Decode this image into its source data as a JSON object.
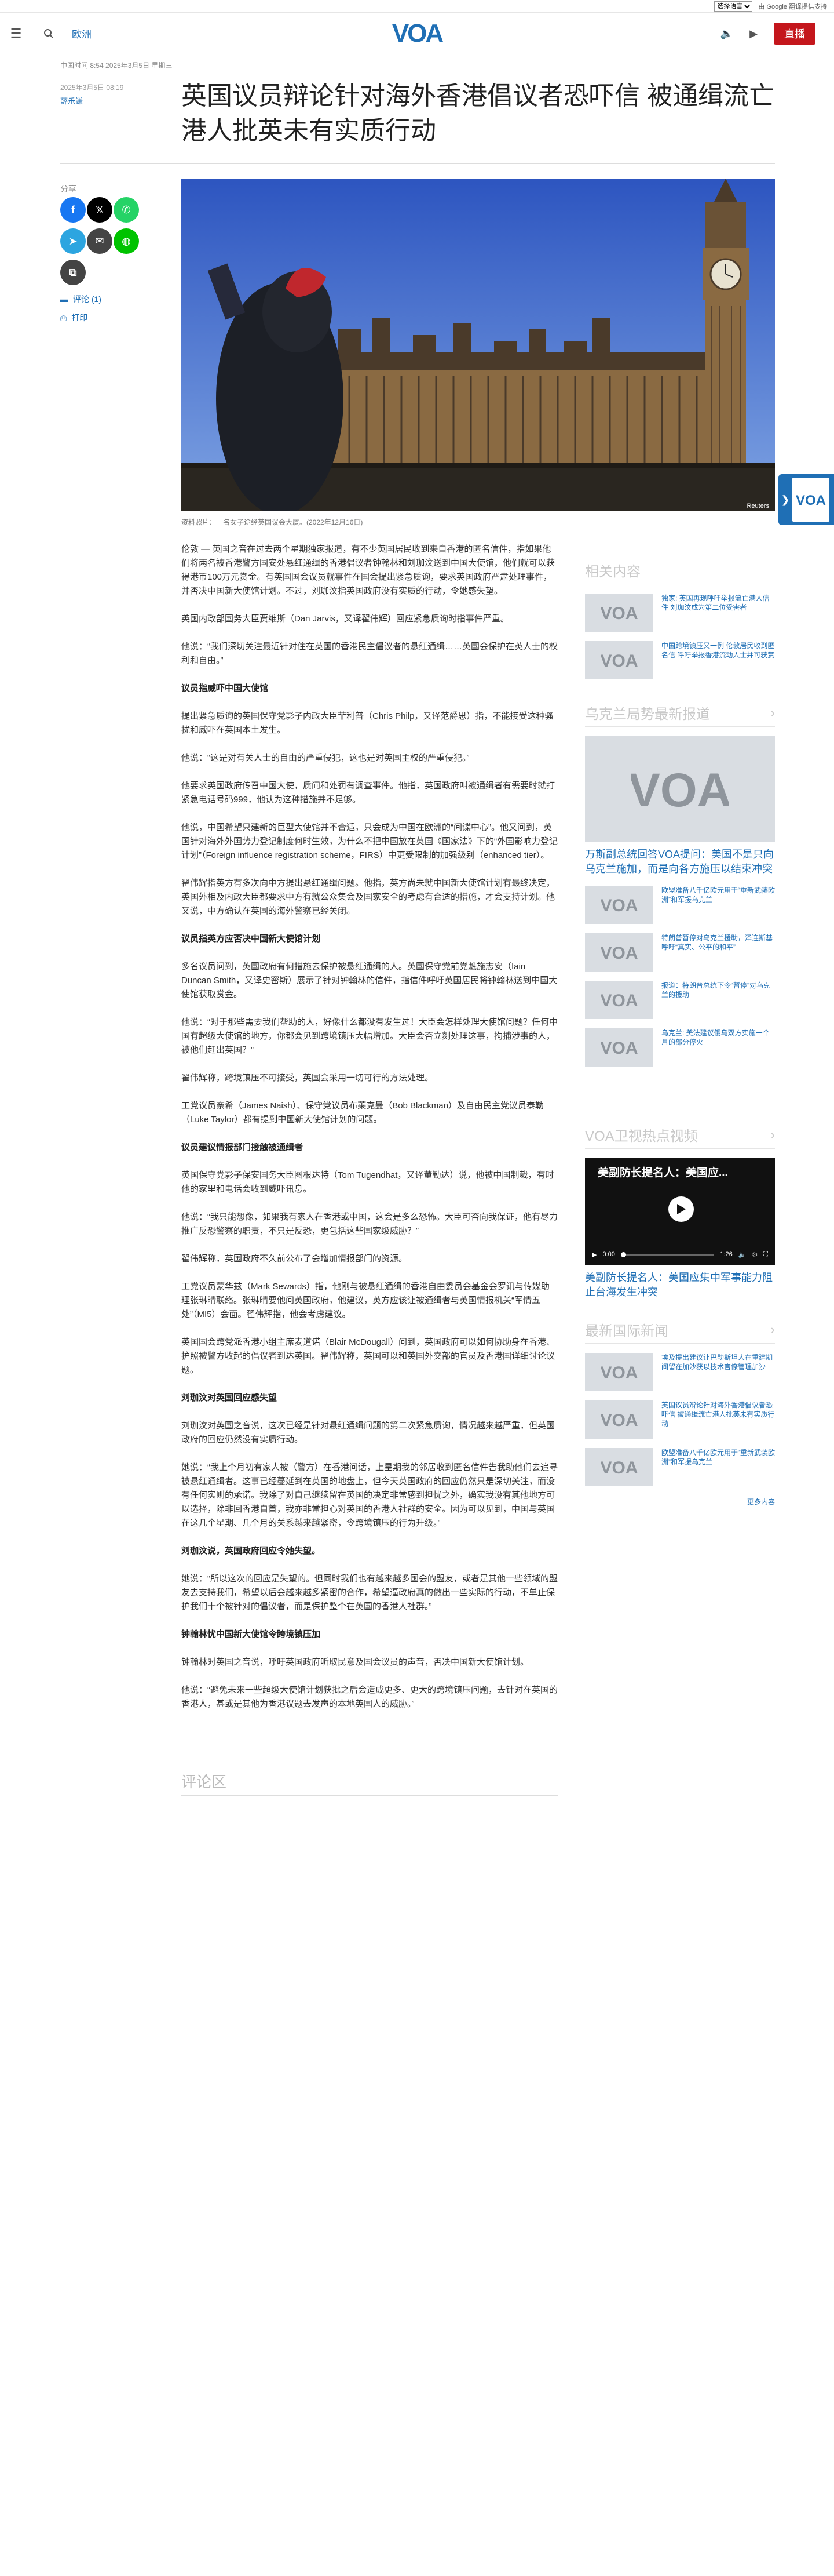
{
  "util": {
    "language_select": "选择语言",
    "translate_label": "由 Google 翻译提供支持"
  },
  "header": {
    "section": "欧洲",
    "logo": "VOA",
    "live_label": "直播"
  },
  "meta": {
    "dates": "中国时间 8:54 2025年3月5日 星期三",
    "updated": "2025年3月5日 08:19",
    "author": "薛乐謙"
  },
  "article": {
    "headline": "英国议员辩论针对海外香港倡议者恐吓信 被通缉流亡港人批英未有实质行动",
    "share_label": "分享",
    "comment_link": "评论 (1)",
    "print_link": "打印",
    "image_caption": "资料照片：一名女子途经英国议会大厦。(2022年12月16日)",
    "image_credit": "Reuters",
    "blocks": [
      {
        "type": "p",
        "text": "伦敦 — 英国之音在过去两个星期独家报道，有不少英国居民收到来自香港的匿名信件，指如果他们将两名被香港警方国安处悬红通缉的香港倡议者钟翰林和刘珈汶送到中国大使馆，他们就可以获得港币100万元赏金。有英国国会议员就事件在国会提出紧急质询，要求英国政府严肃处理事件，并否决中国新大使馆计划。不过，刘珈汶指英国政府没有实质的行动，令她感失望。"
      },
      {
        "type": "p",
        "text": "英国内政部国务大臣贾维斯（Dan Jarvis，又译翟伟辉）回应紧急质询时指事件严重。"
      },
      {
        "type": "p",
        "text": "他说：“我们深切关注最近针对住在英国的香港民主倡议者的悬红通缉……英国会保护在英人士的权利和自由。”"
      },
      {
        "type": "h",
        "text": "议员指威吓中国大使馆"
      },
      {
        "type": "p",
        "text": "提出紧急质询的英国保守党影子内政大臣菲利普（Chris Philp，又译范爵思）指，不能接受这种骚扰和威吓在英国本土发生。"
      },
      {
        "type": "p",
        "text": "他说：“这是对有关人士的自由的严重侵犯，这也是对英国主权的严重侵犯。”"
      },
      {
        "type": "p",
        "text": "他要求英国政府传召中国大使，质问和处罚有调查事件。他指，英国政府叫被通缉者有需要时就打紧急电话号码999，他认为这种措施并不足够。"
      },
      {
        "type": "p",
        "text": "他说，中国希望只建新的巨型大使馆并不合适，只会成为中国在欧洲的“间谍中心”。他又问到，英国针对海外外国势力登记制度何时生效，为什么不把中国放在英国《国家法》下的“外国影响力登记计划”（Foreign influence registration scheme，FIRS）中更受限制的加强级别（enhanced tier）。"
      },
      {
        "type": "p",
        "text": "翟伟辉指英方有多次向中方提出悬红通缉问题。他指，英方尚未就中国新大使馆计划有最终决定，英国外相及内政大臣都要求中方有就公众集会及国家安全的考虑有合适的措施，才会支持计划。他又说，中方确认在英国的海外警察已经关闭。"
      },
      {
        "type": "h",
        "text": "议员指英方应否决中国新大使馆计划"
      },
      {
        "type": "p",
        "text": "多名议员问到，英国政府有何措施去保护被悬红通缉的人。英国保守党前党魁施志安（Iain Duncan Smith，又译史密斯）展示了针对钟翰林的信件，指信件呼吁英国居民将钟翰林送到中国大使馆获取赏金。"
      },
      {
        "type": "p",
        "text": "他说：“对于那些需要我们帮助的人，好像什么都没有发生过！大臣会怎样处理大使馆问题？任何中国有超级大使馆的地方，你都会见到跨境镇压大幅增加。大臣会否立刻处理这事，拘捕涉事的人，被他们赶出英国？”"
      },
      {
        "type": "p",
        "text": "翟伟辉称，跨境镇压不可接受，英国会采用一切可行的方法处理。"
      },
      {
        "type": "p",
        "text": "工党议员奈希（James Naish）、保守党议员布莱克曼（Bob Blackman）及自由民主党议员泰勒（Luke Taylor）都有提到中国新大使馆计划的问题。"
      },
      {
        "type": "h",
        "text": "议员建议情报部门接触被通缉者"
      },
      {
        "type": "p",
        "text": "英国保守党影子保安国务大臣图根达特（Tom Tugendhat，又译董勤达）说，他被中国制裁，有时他的家里和电话会收到威吓讯息。"
      },
      {
        "type": "p",
        "text": "他说：“我只能想像，如果我有家人在香港或中国，这会是多么恐怖。大臣可否向我保证，他有尽力推广反恐警察的职责，不只是反恐，更包括这些国家级威胁？”"
      },
      {
        "type": "p",
        "text": "翟伟辉称，英国政府不久前公布了会增加情报部门的资源。"
      },
      {
        "type": "p",
        "text": "工党议员蒙华兹（Mark Sewards）指，他刚与被悬红通缉的香港自由委员会基金会罗讯与传媒助理张琳晴联络。张琳晴要他问英国政府，他建议，英方应该让被通缉者与英国情报机关“军情五处”（MI5）会面。翟伟辉指，他会考虑建议。"
      },
      {
        "type": "p",
        "text": "英国国会跨党派香港小组主席麦道诺（Blair McDougall）问到，英国政府可以如何协助身在香港、护照被警方收起的倡议者到达英国。翟伟辉称，英国可以和英国外交部的官员及香港国详细讨论议题。"
      },
      {
        "type": "h",
        "text": "刘珈汶对英国回应感失望"
      },
      {
        "type": "p",
        "text": "刘珈汶对英国之音说，这次已经是针对悬红通缉问题的第二次紧急质询，情况越来越严重，但英国政府的回应仍然没有实质行动。"
      },
      {
        "type": "p",
        "text": "她说：“我上个月初有家人被（警方）在香港问话，上星期我的邻居收到匿名信件告我助他们去追寻被悬红通缉者。这事已经蔓延到在英国的地盘上，但今天英国政府的回应仍然只是深切关注，而没有任何实则的承诺。我除了对自己继续留在英国的决定非常感到担忧之外，确实我没有其他地方可以选择，除非回香港自首，我亦非常担心对英国的香港人社群的安全。因为可以见到，中国与英国在这几个星期、几个月的关系越来越紧密，令跨境镇压的行为升级。”"
      },
      {
        "type": "h",
        "text": "刘珈汶说，英国政府回应令她失望。"
      },
      {
        "type": "p",
        "text": "她说：“所以这次的回应是失望的。但同时我们也有越来越多国会的盟友，或者是其他一些领域的盟友去支持我们，希望以后会越来越多紧密的合作，希望逼政府真的做出一些实际的行动，不单止保护我们十个被针对的倡议者，而是保护整个在英国的香港人社群。”"
      },
      {
        "type": "h",
        "text": "钟翰林忧中国新大使馆令跨境镇压加"
      },
      {
        "type": "p",
        "text": "钟翰林对英国之音说，呼吁英国政府听取民意及国会议员的声音，否决中国新大使馆计划。"
      },
      {
        "type": "p",
        "text": "他说：“避免未来一些超级大使馆计划获批之后会造成更多、更大的跨境镇压问题，去针对在英国的香港人，甚或是其他为香港议题去发声的本地英国人的威胁。”"
      }
    ],
    "comments_heading": "评论区"
  },
  "sidebar": {
    "related": {
      "heading": "相关内容",
      "items": [
        {
          "text": "独家: 英国再现呼吁举报流亡港人信件 刘珈汶成为第二位受害者"
        },
        {
          "text": "中国跨境镇压又一例 伦敦居民收到匿名信 呼吁举报香港流动人士并可获赏"
        }
      ]
    },
    "ukraine": {
      "heading": "乌克兰局势最新报道",
      "lead_title": "万斯副总统回答VOA提问：美国不是只向乌克兰施加，而是向各方施压以结束冲突",
      "items": [
        {
          "text": "欧盟准备八千亿欧元用于“重新武装欧洲”和军援乌克兰"
        },
        {
          "text": "特朗普暂停对乌克兰援助，泽连斯基呼吁“真实、公平的和平”"
        },
        {
          "text": "报道：特朗普总统下令“暂停”对乌克兰的援助"
        },
        {
          "text": "乌克兰: 美法建议俄乌双方实施一个月的部分停火"
        }
      ]
    },
    "video": {
      "heading": "VOA卫视热点视频",
      "player_title": "美副防长提名人：美国应...",
      "time_current": "0:00",
      "time_total": "1:26",
      "caption": "美副防长提名人：美国应集中军事能力阻止台海发生冲突"
    },
    "intl": {
      "heading": "最新国际新闻",
      "items": [
        {
          "text": "埃及提出建议让巴勒斯坦人在重建期间留在加沙获以技术官僚管理加沙"
        },
        {
          "text": "英国议员辩论针对海外香港倡议者恐吓信 被通缉流亡港人批英未有实质行动"
        },
        {
          "text": "欧盟准备八千亿欧元用于“重新武装欧洲”和军援乌克兰"
        }
      ],
      "more": "更多内容"
    }
  },
  "colors": {
    "brand_blue": "#1f6fb5",
    "live_red": "#c4161c",
    "facebook": "#1877f2",
    "x": "#000000",
    "whatsapp": "#25d366",
    "telegram": "#2ca5e0",
    "email": "#444444",
    "line": "#00c300",
    "copy": "#444444"
  }
}
